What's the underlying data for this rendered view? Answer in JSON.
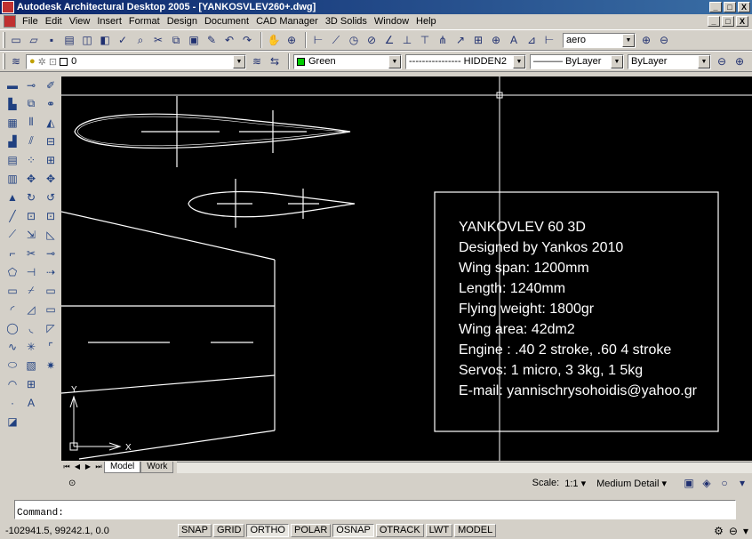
{
  "window": {
    "title": "Autodesk Architectural Desktop 2005 - [YANKOSVLEV260+.dwg]",
    "min": "_",
    "max": "□",
    "close": "X"
  },
  "menu": [
    "File",
    "Edit",
    "View",
    "Insert",
    "Format",
    "Design",
    "Document",
    "CAD Manager",
    "3D Solids",
    "Window",
    "Help"
  ],
  "toolbar1": {
    "style_value": "aero"
  },
  "toolbar2": {
    "layer_value": "0",
    "color_value": "Green",
    "color_hex": "#00cc00",
    "linetype_value": "---------------- HIDDEN2",
    "lineweight_value": "——— ByLayer",
    "plotstyle_value": "ByLayer"
  },
  "titleblock": {
    "lines": [
      "YANKOVLEV 60 3D",
      "Designed by Yankos 2010",
      "Wing span: 1200mm",
      "Length: 1240mm",
      "Flying weight: 1800gr",
      "Wing area: 42dm2",
      "Engine : .40 2 stroke, .60 4 stroke",
      "Servos: 1 micro, 3 3kg, 1 5kg",
      "E-mail: yannischrysohoidis@yahoo.gr"
    ]
  },
  "ucs": {
    "x": "X",
    "y": "Y"
  },
  "tabs": [
    "Model",
    "Work"
  ],
  "drawing_status": {
    "scale_label": "Scale:",
    "scale_value": "1:1 ▾",
    "detail_value": "Medium Detail ▾"
  },
  "command": {
    "prompt": "Command:"
  },
  "status": {
    "coords": "-102941.5, 99242.1, 0.0",
    "toggles": [
      "SNAP",
      "GRID",
      "ORTHO",
      "POLAR",
      "OSNAP",
      "OTRACK",
      "LWT",
      "MODEL"
    ],
    "pressed": [
      "ORTHO",
      "OSNAP"
    ]
  },
  "colors": {
    "canvas": "#000000",
    "linework": "#ffffff",
    "titlebar": "#0a246a"
  }
}
